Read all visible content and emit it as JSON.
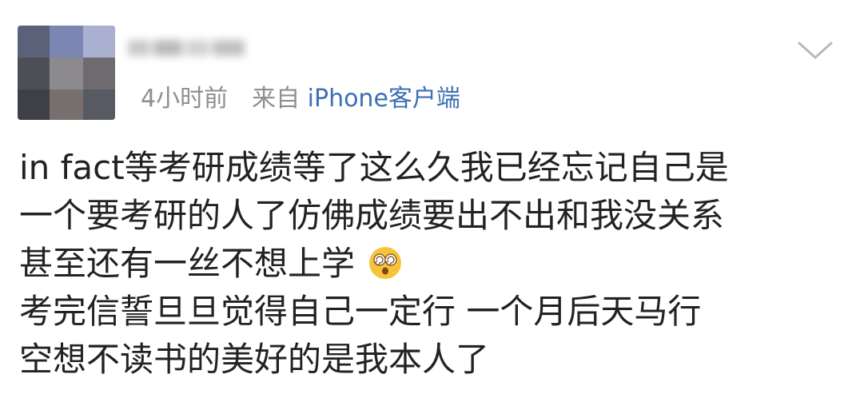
{
  "post_header": {
    "time": "4小时前",
    "source_prefix": "来自",
    "source_link": "iPhone客户端"
  },
  "post_body": {
    "lines": [
      "in fact等考研成绩等了这么久我已经忘记自己是",
      "一个要考研的人了仿佛成绩要出不出和我没关系",
      "甚至还有一丝不想上学",
      "考完信誓旦旦觉得自己一定行 一个月后天马行",
      "空想不读书的美好的是我本人了"
    ],
    "emoji": "dizzy-face-icon"
  },
  "colors": {
    "text": "#222222",
    "meta": "#8e8e93",
    "link": "#3c6fb3"
  }
}
